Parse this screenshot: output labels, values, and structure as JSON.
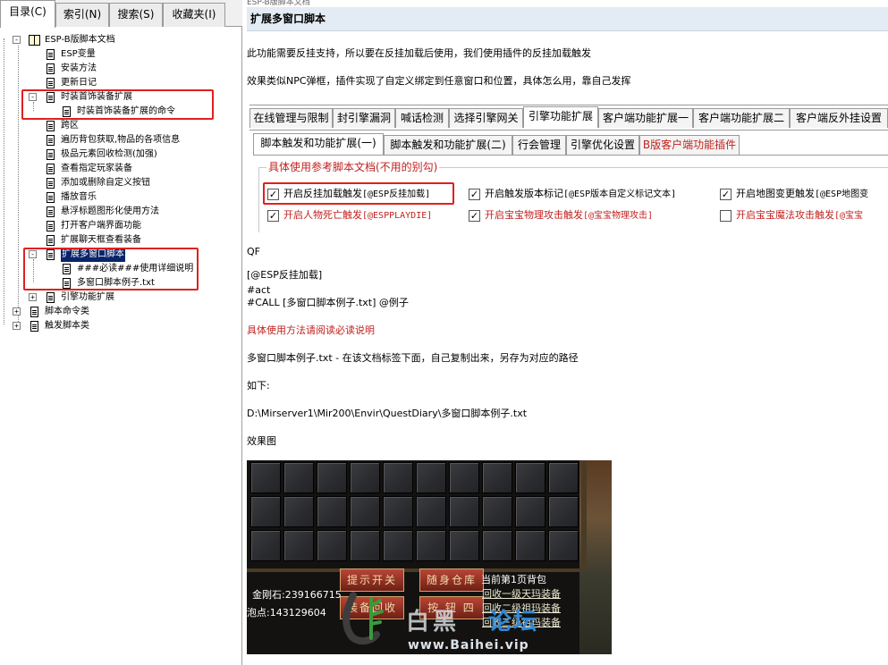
{
  "left_tabs": [
    {
      "label": "目录(C)",
      "active": true
    },
    {
      "label": "索引(N)",
      "active": false
    },
    {
      "label": "搜索(S)",
      "active": false
    },
    {
      "label": "收藏夹(I)",
      "active": false
    }
  ],
  "tree": [
    {
      "label": "ESP-B版脚本文档",
      "level": 0,
      "expander": "-",
      "icon": "book"
    },
    {
      "label": "ESP变量",
      "level": 1,
      "icon": "doc"
    },
    {
      "label": "安装方法",
      "level": 1,
      "icon": "doc"
    },
    {
      "label": "更新日记",
      "level": 1,
      "icon": "doc"
    },
    {
      "label": "时装首饰装备扩展",
      "level": 1,
      "expander": "-",
      "icon": "doc"
    },
    {
      "label": "时装首饰装备扩展的命令",
      "level": 2,
      "icon": "doc"
    },
    {
      "label": "跨区",
      "level": 1,
      "icon": "doc"
    },
    {
      "label": "遍历背包获取,物品的各项信息",
      "level": 1,
      "icon": "doc"
    },
    {
      "label": "极品元素回收检测(加强)",
      "level": 1,
      "icon": "doc"
    },
    {
      "label": "查看指定玩家装备",
      "level": 1,
      "icon": "doc"
    },
    {
      "label": "添加或删除自定义按钮",
      "level": 1,
      "icon": "doc"
    },
    {
      "label": "播放音乐",
      "level": 1,
      "icon": "doc"
    },
    {
      "label": "悬浮标题图形化使用方法",
      "level": 1,
      "icon": "doc"
    },
    {
      "label": "打开客户端界面功能",
      "level": 1,
      "icon": "doc"
    },
    {
      "label": "扩展聊天框查看装备",
      "level": 1,
      "icon": "doc"
    },
    {
      "label": "扩展多窗口脚本",
      "level": 1,
      "expander": "-",
      "icon": "doc",
      "selected": true
    },
    {
      "label": "###必读###使用详细说明",
      "level": 2,
      "icon": "doc"
    },
    {
      "label": "多窗口脚本例子.txt",
      "level": 2,
      "icon": "doc"
    },
    {
      "label": "引擎功能扩展",
      "level": 1,
      "expander": "+",
      "icon": "doc"
    },
    {
      "label": "脚本命令类",
      "level": 0,
      "expander": "+",
      "icon": "doc"
    },
    {
      "label": "触发脚本类",
      "level": 0,
      "expander": "+",
      "icon": "doc"
    }
  ],
  "right": {
    "top_strip": "ESP-B版脚本文档",
    "title": "扩展多窗口脚本",
    "intro1": "此功能需要反挂支持，所以要在反挂加载后使用，我们使用插件的反挂加载触发",
    "intro2": "效果类似NPC弹框，插件实现了自定义绑定到任意窗口和位置，具体怎么用，靠自己发挥",
    "tabs_row1": [
      {
        "label": "在线管理与限制",
        "active": false
      },
      {
        "label": "封引擎漏洞",
        "active": false
      },
      {
        "label": "喊话检测",
        "active": false
      },
      {
        "label": "选择引擎网关",
        "active": false
      },
      {
        "label": "引擎功能扩展",
        "active": true
      },
      {
        "label": "客户端功能扩展一",
        "active": false
      },
      {
        "label": "客户端功能扩展二",
        "active": false
      },
      {
        "label": "客户端反外挂设置",
        "active": false
      }
    ],
    "tabs_row2": [
      {
        "label": "脚本触发和功能扩展(一)",
        "active": true,
        "red": false
      },
      {
        "label": "脚本触发和功能扩展(二)",
        "active": false,
        "red": false
      },
      {
        "label": "行会管理",
        "active": false,
        "red": false
      },
      {
        "label": "引擎优化设置",
        "active": false,
        "red": false
      },
      {
        "label": "B版客户端功能插件",
        "active": false,
        "red": true
      }
    ],
    "group_legend": "具体使用参考脚本文档(不用的别勾)",
    "checkboxes": [
      {
        "label": "开启反挂加载触发",
        "tag": "[@ESP反挂加载]",
        "checked": true,
        "red": false
      },
      {
        "label": "开启触发版本标记",
        "tag": "[@ESP版本自定义标记文本]",
        "checked": true,
        "red": false
      },
      {
        "label": "开启地图变更触发",
        "tag": "[@ESP地图变",
        "checked": true,
        "red": false
      },
      {
        "label": "开启人物死亡触发",
        "tag": "[@ESPPLAYDIE]",
        "checked": true,
        "red": true
      },
      {
        "label": "开启宝宝物理攻击触发",
        "tag": "[@宝宝物理攻击]",
        "checked": true,
        "red": true
      },
      {
        "label": "开启宝宝魔法攻击触发",
        "tag": "[@宝宝",
        "checked": false,
        "red": true
      }
    ],
    "lines": [
      {
        "text": "QF",
        "red": false
      },
      {
        "text": "[@ESP反挂加载]",
        "red": false
      },
      {
        "text": "#act",
        "red": false
      },
      {
        "text": "#CALL [多窗口脚本例子.txt] @例子",
        "red": false
      },
      {
        "text": "具体使用方法请阅读必读说明",
        "red": true
      },
      {
        "text": "多窗口脚本例子.txt - 在该文档标签下面，自己复制出来，另存为对应的路径",
        "red": false
      },
      {
        "text": "如下:",
        "red": false
      },
      {
        "text": "D:\\Mirserver1\\Mir200\\Envir\\QuestDiary\\多窗口脚本例子.txt",
        "red": false
      },
      {
        "text": "效果图",
        "red": false
      }
    ],
    "game": {
      "btn_tips": "提示开关",
      "btn_bag": "随身仓库",
      "btn_recycle": "装备回收",
      "btn_switch": "按 钮 四",
      "current_page": "当前第1页背包",
      "diamond": "金刚石:239166715",
      "bubble": "泡点:143129604",
      "recycle_links": [
        "回收一级天玛装备",
        "回收二级祖玛装备",
        "回收三级祖玛装备"
      ],
      "watermark_small": "www.Baihei.vip",
      "watermark_big": "白黑",
      "watermark_blue": "论坛"
    }
  }
}
